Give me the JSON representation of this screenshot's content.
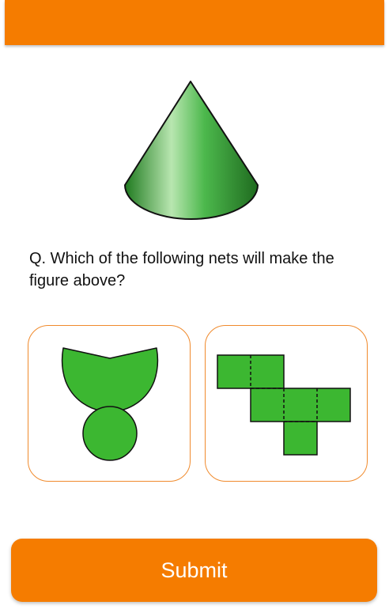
{
  "header": {
    "color": "#f57c00"
  },
  "figure": {
    "shape": "cone",
    "color": "#2e9e2e"
  },
  "question": {
    "text": "Q. Which of the following nets will make the figure above?"
  },
  "options": [
    {
      "id": "a",
      "net": "cone-net",
      "color": "#3cb731"
    },
    {
      "id": "b",
      "net": "cube-net",
      "color": "#3cb731"
    }
  ],
  "submit": {
    "label": "Submit",
    "color": "#f57c00"
  }
}
